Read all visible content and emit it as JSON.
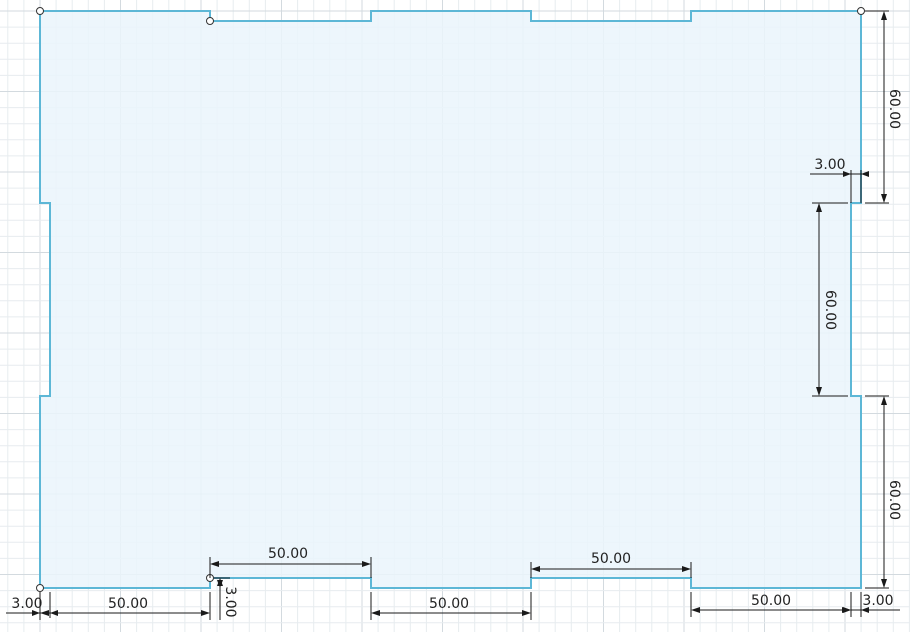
{
  "sketch": {
    "background": "#ffffff",
    "grid_color": "#e7ecef",
    "profile_stroke": "#5db7d6",
    "profile_fill": "#eaf5fb",
    "dimension_color": "#1a1a1a",
    "dimensions": {
      "right_top_height": "60.00",
      "right_mid_height": "60.00",
      "right_bottom_height": "60.00",
      "right_notch_depth": "3.00",
      "bottom_tab_width_1": "50.00",
      "bottom_tab_width_2": "50.00",
      "bottom_left_width": "50.00",
      "bottom_mid_width": "50.00",
      "bottom_right_width": "50.00",
      "left_offset": "3.00",
      "right_offset": "3.00",
      "bottom_notch_depth": "3.00"
    }
  }
}
